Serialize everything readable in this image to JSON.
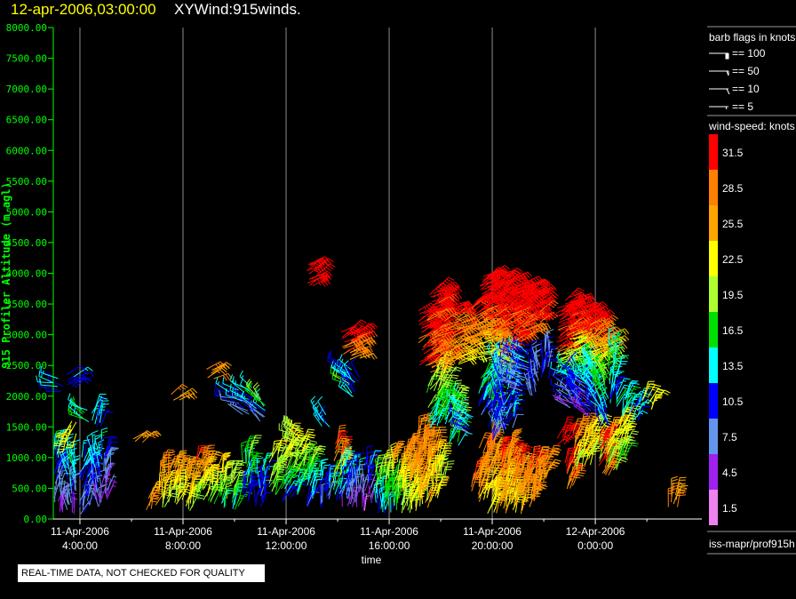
{
  "header": {
    "datetime": "12-apr-2006,03:00:00",
    "product": "XYWind:915winds."
  },
  "footer": {
    "quality_notice": "REAL-TIME DATA, NOT CHECKED FOR QUALITY",
    "source": "iss-mapr/prof915h"
  },
  "legend": {
    "barb_title": "barb flags in knots",
    "barb_items": [
      {
        "label": "== 100",
        "value": 100
      },
      {
        "label": "== 50",
        "value": 50
      },
      {
        "label": "== 10",
        "value": 10
      },
      {
        "label": "== 5",
        "value": 5
      }
    ],
    "speed_title": "wind-speed: knots",
    "speed_bins": [
      {
        "label": "31.5",
        "color": "#ff0000"
      },
      {
        "label": "28.5",
        "color": "#ff8000"
      },
      {
        "label": "25.5",
        "color": "#ffa500"
      },
      {
        "label": "22.5",
        "color": "#ffff00"
      },
      {
        "label": "19.5",
        "color": "#adff2f"
      },
      {
        "label": "16.5",
        "color": "#00e000"
      },
      {
        "label": "13.5",
        "color": "#00ffff"
      },
      {
        "label": "10.5",
        "color": "#0000ff"
      },
      {
        "label": "7.5",
        "color": "#6495ed"
      },
      {
        "label": "4.5",
        "color": "#a020f0"
      },
      {
        "label": "1.5",
        "color": "#ee82ee"
      }
    ]
  },
  "chart_data": {
    "type": "wind-barb time-height",
    "xlabel": "time",
    "ylabel": "915 Profiler Altitude (m agl)",
    "ylim": [
      0,
      8000
    ],
    "xlim": [
      "2006-04-11T02:58",
      "2006-04-12T04:08"
    ],
    "y_ticks": [
      "0.00",
      "500.00",
      "1000.00",
      "1500.00",
      "2000.00",
      "2500.00",
      "3000.00",
      "3500.00",
      "4000.00",
      "4500.00",
      "5000.00",
      "5500.00",
      "6000.00",
      "6500.00",
      "7000.00",
      "7500.00",
      "8000.00"
    ],
    "x_ticks": [
      {
        "date": "11-Apr-2006",
        "time": "4:00:00",
        "t": "2006-04-11T04:00"
      },
      {
        "date": "11-Apr-2006",
        "time": "8:00:00",
        "t": "2006-04-11T08:00"
      },
      {
        "date": "11-Apr-2006",
        "time": "12:00:00",
        "t": "2006-04-11T12:00"
      },
      {
        "date": "11-Apr-2006",
        "time": "16:00:00",
        "t": "2006-04-11T16:00"
      },
      {
        "date": "11-Apr-2006",
        "time": "20:00:00",
        "t": "2006-04-11T20:00"
      },
      {
        "date": "12-Apr-2006",
        "time": "0:00:00",
        "t": "2006-04-12T00:00"
      }
    ],
    "grid": "vertical at major time ticks",
    "layer_columns": [
      "alt_bottom_m",
      "alt_top_m",
      "speed_bottom_kt",
      "speed_top_kt",
      "direction_deg"
    ],
    "profiles": [
      {
        "t": "2006-04-11T03:10",
        "layers": [
          [
            100,
            1200,
            4,
            14,
            10
          ],
          [
            2100,
            2300,
            12,
            12,
            280
          ]
        ]
      },
      {
        "t": "2006-04-11T03:40",
        "layers": [
          [
            100,
            1100,
            6,
            16,
            350
          ],
          [
            1400,
            1600,
            22,
            22,
            200
          ],
          [
            2150,
            2350,
            10,
            12,
            60
          ]
        ]
      },
      {
        "t": "2006-04-11T04:10",
        "layers": [
          [
            100,
            1000,
            8,
            12,
            20
          ],
          [
            1600,
            1800,
            14,
            14,
            300
          ]
        ]
      },
      {
        "t": "2006-04-11T04:40",
        "layers": [
          [
            200,
            1200,
            6,
            14,
            350
          ],
          [
            1500,
            1750,
            12,
            14,
            20
          ]
        ]
      },
      {
        "t": "2006-04-11T05:00",
        "layers": [
          [
            300,
            1100,
            4,
            10,
            10
          ]
        ]
      },
      {
        "t": "2006-04-11T06:15",
        "layers": [
          [
            1250,
            1350,
            27,
            27,
            60
          ]
        ]
      },
      {
        "t": "2006-04-11T06:45",
        "layers": [
          [
            150,
            350,
            27,
            27,
            20
          ]
        ]
      },
      {
        "t": "2006-04-11T07:15",
        "layers": [
          [
            200,
            900,
            20,
            28,
            15
          ]
        ]
      },
      {
        "t": "2006-04-11T07:40",
        "layers": [
          [
            250,
            850,
            22,
            26,
            20
          ],
          [
            1950,
            2050,
            26,
            26,
            60
          ]
        ]
      },
      {
        "t": "2006-04-11T08:10",
        "layers": [
          [
            150,
            800,
            20,
            27,
            15
          ]
        ]
      },
      {
        "t": "2006-04-11T08:40",
        "layers": [
          [
            300,
            1000,
            17,
            31,
            20
          ]
        ]
      },
      {
        "t": "2006-04-11T09:00",
        "layers": [
          [
            250,
            900,
            18,
            26,
            15
          ],
          [
            2300,
            2450,
            27,
            27,
            60
          ]
        ]
      },
      {
        "t": "2006-04-11T09:30",
        "layers": [
          [
            200,
            800,
            16,
            24,
            10
          ]
        ]
      },
      {
        "t": "2006-04-11T10:00",
        "layers": [
          [
            150,
            700,
            14,
            20,
            20
          ],
          [
            1900,
            2100,
            8,
            12,
            290
          ]
        ]
      },
      {
        "t": "2006-04-11T10:30",
        "layers": [
          [
            300,
            1100,
            10,
            18,
            10
          ],
          [
            1700,
            2150,
            8,
            14,
            300
          ]
        ]
      },
      {
        "t": "2006-04-11T11:00",
        "layers": [
          [
            200,
            800,
            8,
            14,
            5
          ],
          [
            1600,
            2000,
            5,
            22,
            320
          ]
        ]
      },
      {
        "t": "2006-04-11T11:30",
        "layers": [
          [
            400,
            1100,
            16,
            22,
            20
          ]
        ]
      },
      {
        "t": "2006-04-11T12:00",
        "layers": [
          [
            300,
            1300,
            12,
            24,
            30
          ]
        ]
      },
      {
        "t": "2006-04-11T12:30",
        "layers": [
          [
            400,
            1200,
            14,
            22,
            20
          ],
          [
            1200,
            1500,
            20,
            20,
            300
          ]
        ]
      },
      {
        "t": "2006-04-11T13:00",
        "layers": [
          [
            200,
            1000,
            10,
            18,
            15
          ],
          [
            3800,
            4200,
            32,
            32,
            60
          ]
        ]
      },
      {
        "t": "2006-04-11T13:30",
        "layers": [
          [
            200,
            700,
            8,
            14,
            10
          ],
          [
            1500,
            1700,
            13,
            13,
            330
          ]
        ]
      },
      {
        "t": "2006-04-11T14:00",
        "layers": [
          [
            300,
            1200,
            10,
            31,
            20
          ]
        ]
      },
      {
        "t": "2006-04-11T14:20",
        "layers": [
          [
            200,
            900,
            6,
            14,
            10
          ],
          [
            2700,
            3100,
            30,
            33,
            60
          ],
          [
            2200,
            2500,
            18,
            10,
            300
          ]
        ]
      },
      {
        "t": "2006-04-11T14:40",
        "layers": [
          [
            200,
            800,
            4,
            12,
            5
          ],
          [
            2600,
            3050,
            26,
            33,
            60
          ],
          [
            2000,
            2300,
            14,
            12,
            320
          ]
        ]
      },
      {
        "t": "2006-04-11T15:10",
        "layers": [
          [
            150,
            900,
            4,
            12,
            5
          ]
        ]
      },
      {
        "t": "2006-04-11T15:40",
        "layers": [
          [
            100,
            800,
            12,
            20,
            5
          ]
        ]
      },
      {
        "t": "2006-04-11T16:00",
        "layers": [
          [
            100,
            900,
            12,
            22,
            5
          ]
        ]
      },
      {
        "t": "2006-04-11T16:20",
        "layers": [
          [
            150,
            1000,
            16,
            26,
            10
          ]
        ]
      },
      {
        "t": "2006-04-11T16:40",
        "layers": [
          [
            100,
            1100,
            20,
            27,
            10
          ]
        ]
      },
      {
        "t": "2006-04-11T17:00",
        "layers": [
          [
            150,
            1200,
            22,
            28,
            10
          ]
        ]
      },
      {
        "t": "2006-04-11T17:20",
        "layers": [
          [
            200,
            1500,
            24,
            28,
            10
          ],
          [
            2500,
            3400,
            30,
            33,
            60
          ]
        ]
      },
      {
        "t": "2006-04-11T17:40",
        "layers": [
          [
            300,
            1300,
            22,
            28,
            10
          ],
          [
            1500,
            2200,
            14,
            20,
            30
          ],
          [
            2400,
            3700,
            28,
            33,
            60
          ]
        ]
      },
      {
        "t": "2006-04-11T18:00",
        "layers": [
          [
            600,
            1000,
            20,
            24,
            10
          ],
          [
            1500,
            2500,
            14,
            22,
            20
          ],
          [
            2500,
            3800,
            28,
            33,
            60
          ]
        ]
      },
      {
        "t": "2006-04-11T18:30",
        "layers": [
          [
            1200,
            2000,
            14,
            20,
            20
          ],
          [
            2500,
            3500,
            24,
            33,
            65
          ]
        ]
      },
      {
        "t": "2006-04-11T19:00",
        "layers": [
          [
            1400,
            2000,
            10,
            16,
            300
          ],
          [
            2600,
            3200,
            22,
            30,
            70
          ]
        ]
      },
      {
        "t": "2006-04-11T19:20",
        "layers": [
          [
            400,
            800,
            28,
            30,
            15
          ],
          [
            2900,
            3600,
            26,
            33,
            60
          ]
        ]
      },
      {
        "t": "2006-04-11T19:40",
        "layers": [
          [
            300,
            1200,
            24,
            30,
            20
          ],
          [
            1700,
            2400,
            10,
            16,
            30
          ],
          [
            2600,
            3300,
            20,
            28,
            80
          ],
          [
            3300,
            4000,
            30,
            33,
            60
          ]
        ]
      },
      {
        "t": "2006-04-11T20:00",
        "layers": [
          [
            100,
            1300,
            22,
            28,
            15
          ],
          [
            1300,
            2300,
            10,
            16,
            20
          ],
          [
            2500,
            3000,
            20,
            28,
            75
          ],
          [
            3000,
            4000,
            30,
            33,
            60
          ]
        ]
      },
      {
        "t": "2006-04-11T20:20",
        "layers": [
          [
            100,
            1100,
            24,
            31,
            15
          ],
          [
            1400,
            2600,
            8,
            14,
            340
          ],
          [
            2700,
            3900,
            28,
            33,
            60
          ]
        ]
      },
      {
        "t": "2006-04-11T20:40",
        "layers": [
          [
            200,
            1200,
            22,
            28,
            15
          ],
          [
            1500,
            2400,
            10,
            14,
            20
          ],
          [
            2800,
            3900,
            30,
            33,
            60
          ]
        ]
      },
      {
        "t": "2006-04-11T21:00",
        "layers": [
          [
            100,
            1000,
            24,
            31,
            15
          ],
          [
            2100,
            2700,
            6,
            10,
            290
          ],
          [
            2900,
            3800,
            30,
            33,
            60
          ]
        ]
      },
      {
        "t": "2006-04-11T21:20",
        "layers": [
          [
            200,
            800,
            26,
            28,
            15
          ],
          [
            2200,
            2800,
            8,
            12,
            300
          ],
          [
            3000,
            3800,
            28,
            33,
            60
          ]
        ]
      },
      {
        "t": "2006-04-11T21:40",
        "layers": [
          [
            300,
            1000,
            26,
            31,
            15
          ],
          [
            2000,
            2600,
            8,
            10,
            350
          ],
          [
            3200,
            3700,
            30,
            33,
            60
          ]
        ]
      },
      {
        "t": "2006-04-11T22:00",
        "layers": [
          [
            600,
            1000,
            27,
            28,
            20
          ],
          [
            2300,
            2800,
            10,
            8,
            10
          ]
        ]
      },
      {
        "t": "2006-04-11T22:40",
        "layers": [
          [
            1200,
            1400,
            32,
            32,
            30
          ],
          [
            2700,
            3500,
            30,
            33,
            60
          ],
          [
            2300,
            2700,
            14,
            22,
            70
          ]
        ]
      },
      {
        "t": "2006-04-11T23:00",
        "layers": [
          [
            500,
            1000,
            28,
            32,
            20
          ],
          [
            1800,
            2500,
            6,
            14,
            300
          ],
          [
            2500,
            3000,
            18,
            26,
            70
          ],
          [
            3000,
            3600,
            30,
            33,
            60
          ]
        ]
      },
      {
        "t": "2006-04-11T23:20",
        "layers": [
          [
            800,
            1500,
            18,
            30,
            20
          ],
          [
            1800,
            2400,
            8,
            12,
            330
          ],
          [
            2400,
            3000,
            14,
            24,
            70
          ],
          [
            3000,
            3500,
            30,
            33,
            60
          ]
        ]
      },
      {
        "t": "2006-04-11T23:40",
        "layers": [
          [
            900,
            1400,
            22,
            26,
            20
          ],
          [
            1700,
            2300,
            4,
            12,
            300
          ],
          [
            2300,
            2900,
            16,
            26,
            70
          ],
          [
            2900,
            3400,
            30,
            33,
            60
          ]
        ]
      },
      {
        "t": "2006-04-12T00:00",
        "layers": [
          [
            1000,
            1500,
            20,
            24,
            30
          ],
          [
            1700,
            2600,
            10,
            14,
            320
          ],
          [
            2600,
            3300,
            24,
            31,
            60
          ]
        ]
      },
      {
        "t": "2006-04-12T00:20",
        "layers": [
          [
            700,
            1300,
            28,
            32,
            20
          ],
          [
            1500,
            2400,
            10,
            18,
            340
          ],
          [
            2500,
            3000,
            18,
            28,
            60
          ]
        ]
      },
      {
        "t": "2006-04-12T00:40",
        "layers": [
          [
            800,
            1400,
            18,
            24,
            20
          ],
          [
            1900,
            2800,
            12,
            16,
            10
          ]
        ]
      },
      {
        "t": "2006-04-12T01:00",
        "layers": [
          [
            1000,
            1600,
            18,
            24,
            20
          ],
          [
            1700,
            2000,
            14,
            14,
            20
          ]
        ]
      },
      {
        "t": "2006-04-12T01:30",
        "layers": [
          [
            1600,
            1900,
            12,
            13,
            30
          ]
        ]
      },
      {
        "t": "2006-04-12T02:00",
        "layers": [
          [
            1800,
            2000,
            22,
            22,
            30
          ]
        ]
      },
      {
        "t": "2006-04-12T03:00",
        "layers": [
          [
            200,
            400,
            27,
            27,
            10
          ]
        ]
      }
    ]
  }
}
